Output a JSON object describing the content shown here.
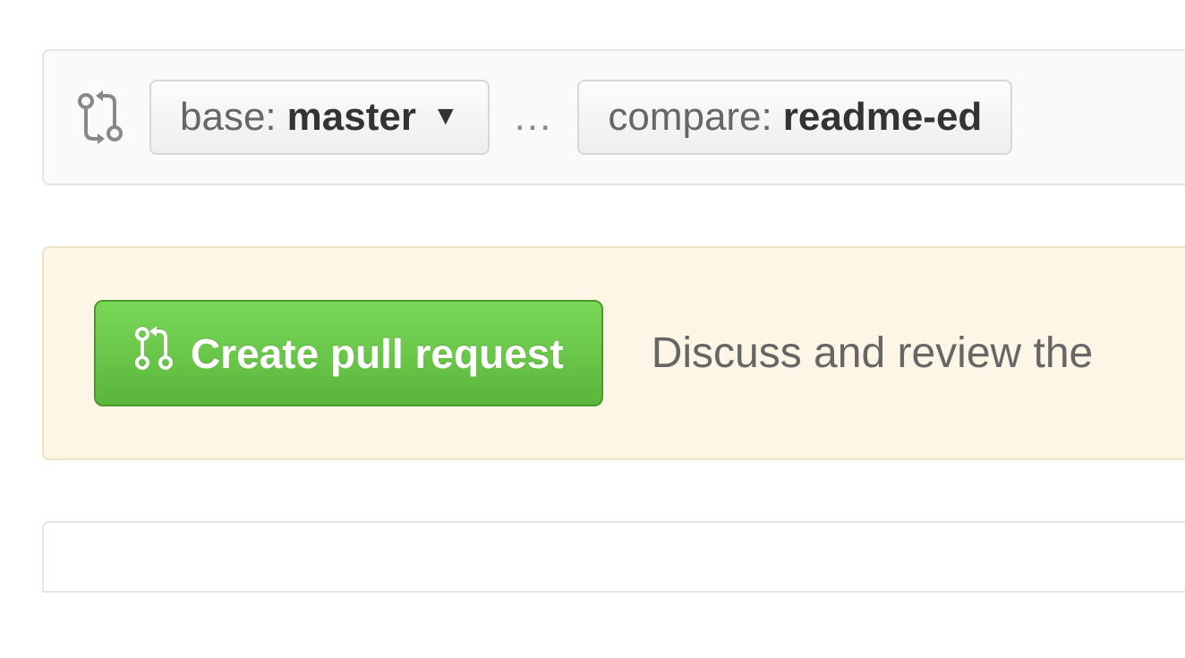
{
  "compare": {
    "base_prefix": "base:",
    "base_branch": "master",
    "separator": "...",
    "compare_prefix": "compare:",
    "compare_branch": "readme-ed"
  },
  "action": {
    "button_label": "Create pull request",
    "description": "Discuss and review the"
  }
}
